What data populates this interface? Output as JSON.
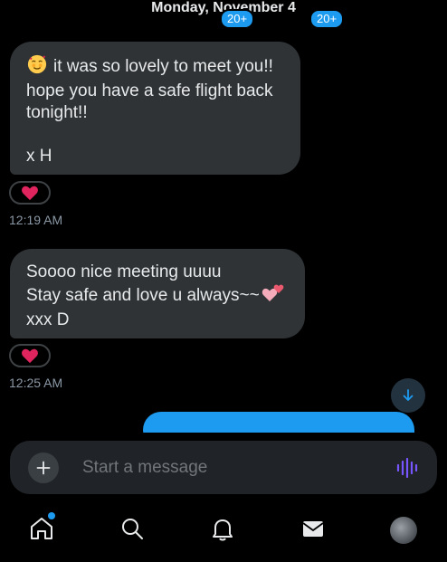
{
  "thread": {
    "date_header": "Monday, November 4",
    "messages": [
      {
        "emoji": "smiling-face-with-hearts",
        "lines": [
          "it was so lovely to meet you!!",
          "hope you have a safe flight back",
          "tonight!!",
          "",
          "x H"
        ],
        "reaction": "red-heart",
        "time": "12:19 AM"
      },
      {
        "lines": [
          "Soooo nice meeting uuuu",
          "Stay safe and love u always~~",
          "xxx D"
        ],
        "trailing_emoji": "two-hearts",
        "reaction": "red-heart",
        "time": "12:25 AM"
      }
    ],
    "sent_bubble_color": "#1d9bf0"
  },
  "composer": {
    "placeholder": "Start a message"
  },
  "nav": {
    "notifications_badge": "20+",
    "messages_badge": "20+"
  },
  "colors": {
    "accent": "#1d9bf0",
    "bubble": "#2f3336",
    "background": "#000000",
    "heart": "#f91880"
  }
}
